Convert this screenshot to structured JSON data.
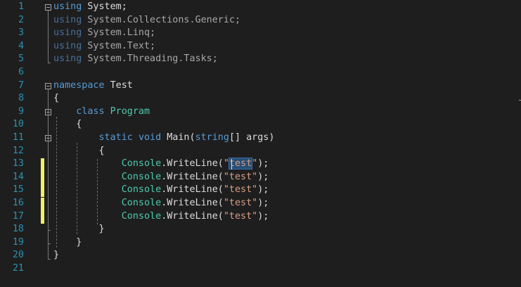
{
  "editor": {
    "lines": [
      {
        "n": "1",
        "segs": [
          {
            "t": "using",
            "c": "kw"
          },
          {
            "t": " System;",
            "c": ""
          }
        ]
      },
      {
        "n": "2",
        "segs": [
          {
            "t": "using",
            "c": "kw-dim"
          },
          {
            "t": " System.Collections.Generic;",
            "c": "id-dim"
          }
        ]
      },
      {
        "n": "3",
        "segs": [
          {
            "t": "using",
            "c": "kw-dim"
          },
          {
            "t": " System.Linq;",
            "c": "id-dim"
          }
        ]
      },
      {
        "n": "4",
        "segs": [
          {
            "t": "using",
            "c": "kw-dim"
          },
          {
            "t": " System.Text;",
            "c": "id-dim"
          }
        ]
      },
      {
        "n": "5",
        "segs": [
          {
            "t": "using",
            "c": "kw-dim"
          },
          {
            "t": " System.Threading.Tasks;",
            "c": "id-dim"
          }
        ]
      },
      {
        "n": "6",
        "segs": []
      },
      {
        "n": "7",
        "segs": [
          {
            "t": "namespace",
            "c": "kw"
          },
          {
            "t": " Test",
            "c": ""
          }
        ]
      },
      {
        "n": "8",
        "segs": [
          {
            "t": "{",
            "c": ""
          }
        ]
      },
      {
        "n": "9",
        "segs": [
          {
            "t": "    ",
            "c": ""
          },
          {
            "t": "class",
            "c": "kw"
          },
          {
            "t": " ",
            "c": ""
          },
          {
            "t": "Program",
            "c": "type"
          }
        ]
      },
      {
        "n": "10",
        "segs": [
          {
            "t": "    {",
            "c": ""
          }
        ]
      },
      {
        "n": "11",
        "segs": [
          {
            "t": "        ",
            "c": ""
          },
          {
            "t": "static",
            "c": "kw"
          },
          {
            "t": " ",
            "c": ""
          },
          {
            "t": "void",
            "c": "kw"
          },
          {
            "t": " Main(",
            "c": ""
          },
          {
            "t": "string",
            "c": "kw"
          },
          {
            "t": "[] args)",
            "c": ""
          }
        ]
      },
      {
        "n": "12",
        "segs": [
          {
            "t": "        {",
            "c": ""
          }
        ]
      },
      {
        "n": "13",
        "segs": [
          {
            "t": "            ",
            "c": ""
          },
          {
            "t": "Console",
            "c": "type"
          },
          {
            "t": ".WriteLine(",
            "c": ""
          },
          {
            "t": "\"",
            "c": "str"
          },
          {
            "t": "test",
            "c": "str hl"
          },
          {
            "t": "\"",
            "c": "str"
          },
          {
            "t": ");",
            "c": ""
          }
        ]
      },
      {
        "n": "14",
        "segs": [
          {
            "t": "            ",
            "c": ""
          },
          {
            "t": "Console",
            "c": "type"
          },
          {
            "t": ".WriteLine(",
            "c": ""
          },
          {
            "t": "\"test\"",
            "c": "str"
          },
          {
            "t": ");",
            "c": ""
          }
        ]
      },
      {
        "n": "15",
        "segs": [
          {
            "t": "            ",
            "c": ""
          },
          {
            "t": "Console",
            "c": "type"
          },
          {
            "t": ".WriteLine(",
            "c": ""
          },
          {
            "t": "\"test\"",
            "c": "str"
          },
          {
            "t": ");",
            "c": ""
          }
        ]
      },
      {
        "n": "16",
        "segs": [
          {
            "t": "            ",
            "c": ""
          },
          {
            "t": "Console",
            "c": "type"
          },
          {
            "t": ".WriteLine(",
            "c": ""
          },
          {
            "t": "\"test\"",
            "c": "str"
          },
          {
            "t": ");",
            "c": ""
          }
        ]
      },
      {
        "n": "17",
        "segs": [
          {
            "t": "            ",
            "c": ""
          },
          {
            "t": "Console",
            "c": "type"
          },
          {
            "t": ".WriteLine(",
            "c": ""
          },
          {
            "t": "\"test\"",
            "c": "str"
          },
          {
            "t": ");",
            "c": ""
          }
        ]
      },
      {
        "n": "18",
        "segs": [
          {
            "t": "        }",
            "c": ""
          }
        ]
      },
      {
        "n": "19",
        "segs": [
          {
            "t": "    }",
            "c": ""
          }
        ]
      },
      {
        "n": "20",
        "segs": [
          {
            "t": "}",
            "c": ""
          }
        ]
      },
      {
        "n": "21",
        "segs": []
      }
    ],
    "fold_lines": [
      1,
      7,
      9,
      11
    ],
    "changed_lines": [
      13,
      14,
      15,
      16,
      17
    ],
    "selected_text": "test",
    "colors": {
      "background": "#1e1e1e",
      "line_number": "#2b91af",
      "keyword": "#569cd6",
      "type": "#4ec9b0",
      "string": "#d69d85",
      "change_marker": "#efef6a",
      "selection": "#264f78"
    }
  }
}
